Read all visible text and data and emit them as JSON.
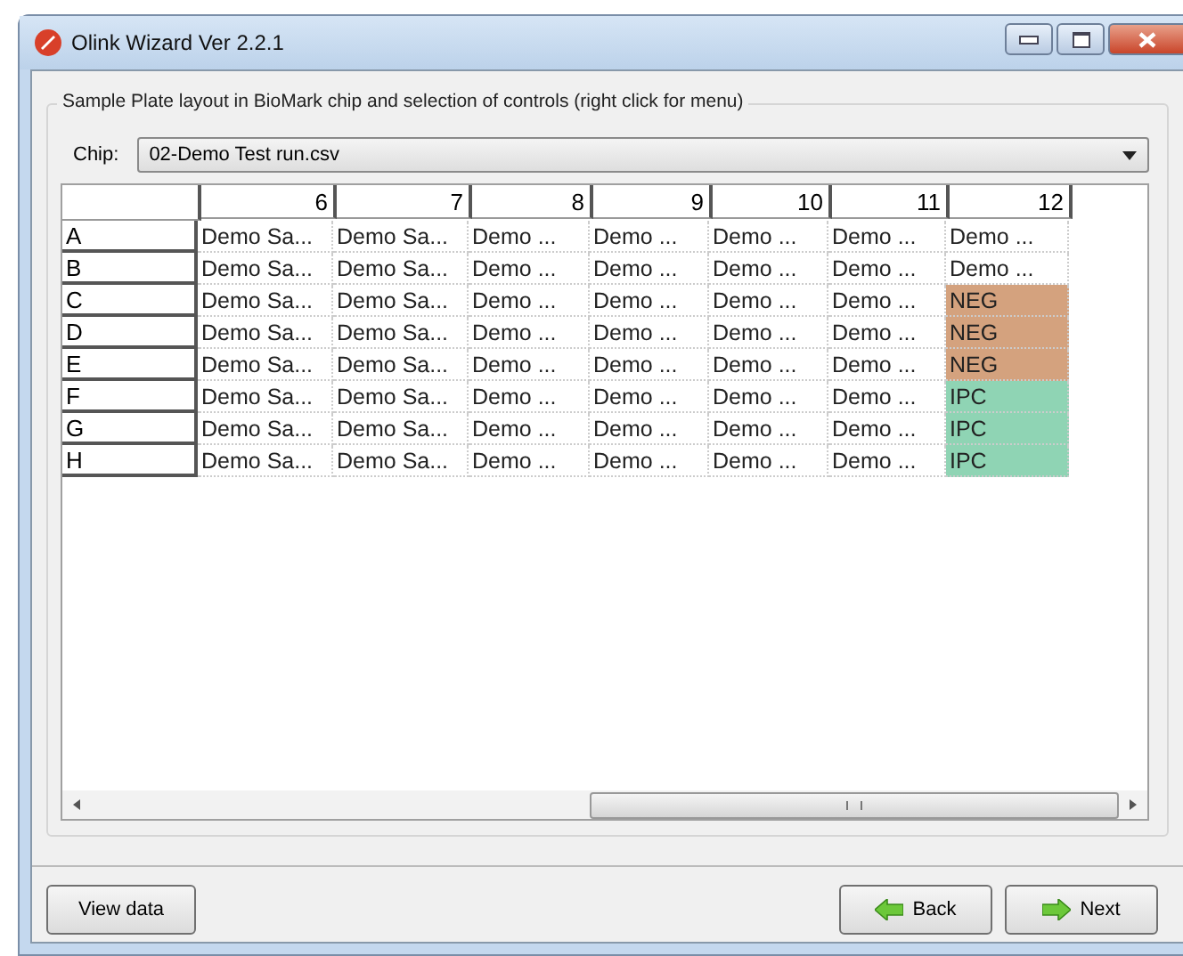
{
  "window": {
    "title": "Olink Wizard Ver 2.2.1"
  },
  "group": {
    "title": "Sample Plate layout in BioMark chip and selection of controls (right click for menu)"
  },
  "chip": {
    "label": "Chip:",
    "value": "02-Demo Test run.csv"
  },
  "table": {
    "columns": [
      "6",
      "7",
      "8",
      "9",
      "10",
      "11",
      "12"
    ],
    "rows": [
      {
        "label": "A",
        "cells": [
          {
            "text": "Demo Sa...",
            "kind": "sample"
          },
          {
            "text": "Demo Sa...",
            "kind": "sample"
          },
          {
            "text": "Demo ...",
            "kind": "sample"
          },
          {
            "text": "Demo ...",
            "kind": "sample"
          },
          {
            "text": "Demo ...",
            "kind": "sample"
          },
          {
            "text": "Demo ...",
            "kind": "sample"
          },
          {
            "text": "Demo ...",
            "kind": "sample"
          }
        ]
      },
      {
        "label": "B",
        "cells": [
          {
            "text": "Demo Sa...",
            "kind": "sample"
          },
          {
            "text": "Demo Sa...",
            "kind": "sample"
          },
          {
            "text": "Demo ...",
            "kind": "sample"
          },
          {
            "text": "Demo ...",
            "kind": "sample"
          },
          {
            "text": "Demo ...",
            "kind": "sample"
          },
          {
            "text": "Demo ...",
            "kind": "sample"
          },
          {
            "text": "Demo ...",
            "kind": "sample"
          }
        ]
      },
      {
        "label": "C",
        "cells": [
          {
            "text": "Demo Sa...",
            "kind": "sample"
          },
          {
            "text": "Demo Sa...",
            "kind": "sample"
          },
          {
            "text": "Demo ...",
            "kind": "sample"
          },
          {
            "text": "Demo ...",
            "kind": "sample"
          },
          {
            "text": "Demo ...",
            "kind": "sample"
          },
          {
            "text": "Demo ...",
            "kind": "sample"
          },
          {
            "text": "NEG",
            "kind": "negative"
          }
        ]
      },
      {
        "label": "D",
        "cells": [
          {
            "text": "Demo Sa...",
            "kind": "sample"
          },
          {
            "text": "Demo Sa...",
            "kind": "sample"
          },
          {
            "text": "Demo ...",
            "kind": "sample"
          },
          {
            "text": "Demo ...",
            "kind": "sample"
          },
          {
            "text": "Demo ...",
            "kind": "sample"
          },
          {
            "text": "Demo ...",
            "kind": "sample"
          },
          {
            "text": "NEG",
            "kind": "negative"
          }
        ]
      },
      {
        "label": "E",
        "cells": [
          {
            "text": "Demo Sa...",
            "kind": "sample"
          },
          {
            "text": "Demo Sa...",
            "kind": "sample"
          },
          {
            "text": "Demo ...",
            "kind": "sample"
          },
          {
            "text": "Demo ...",
            "kind": "sample"
          },
          {
            "text": "Demo ...",
            "kind": "sample"
          },
          {
            "text": "Demo ...",
            "kind": "sample"
          },
          {
            "text": "NEG",
            "kind": "negative"
          }
        ]
      },
      {
        "label": "F",
        "cells": [
          {
            "text": "Demo Sa...",
            "kind": "sample"
          },
          {
            "text": "Demo Sa...",
            "kind": "sample"
          },
          {
            "text": "Demo ...",
            "kind": "sample"
          },
          {
            "text": "Demo ...",
            "kind": "sample"
          },
          {
            "text": "Demo ...",
            "kind": "sample"
          },
          {
            "text": "Demo ...",
            "kind": "sample"
          },
          {
            "text": "IPC",
            "kind": "ipc"
          }
        ]
      },
      {
        "label": "G",
        "cells": [
          {
            "text": "Demo Sa...",
            "kind": "sample"
          },
          {
            "text": "Demo Sa...",
            "kind": "sample"
          },
          {
            "text": "Demo ...",
            "kind": "sample"
          },
          {
            "text": "Demo ...",
            "kind": "sample"
          },
          {
            "text": "Demo ...",
            "kind": "sample"
          },
          {
            "text": "Demo ...",
            "kind": "sample"
          },
          {
            "text": "IPC",
            "kind": "ipc"
          }
        ]
      },
      {
        "label": "H",
        "cells": [
          {
            "text": "Demo Sa...",
            "kind": "sample"
          },
          {
            "text": "Demo Sa...",
            "kind": "sample"
          },
          {
            "text": "Demo ...",
            "kind": "sample"
          },
          {
            "text": "Demo ...",
            "kind": "sample"
          },
          {
            "text": "Demo ...",
            "kind": "sample"
          },
          {
            "text": "Demo ...",
            "kind": "sample"
          },
          {
            "text": "IPC",
            "kind": "ipc"
          }
        ]
      }
    ]
  },
  "buttons": [
    {
      "label": "View data",
      "kind": "plain"
    },
    {
      "label": "Back",
      "kind": "back"
    },
    {
      "label": "Next",
      "kind": "next"
    }
  ]
}
